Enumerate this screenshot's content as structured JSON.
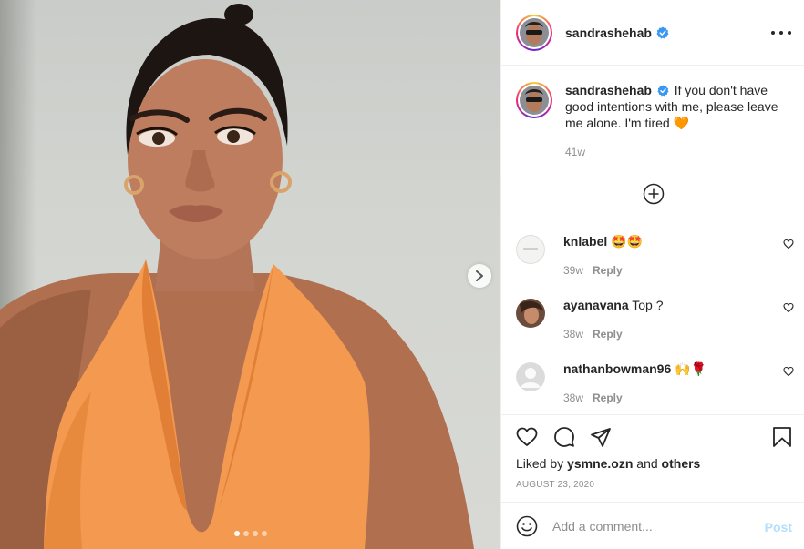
{
  "post": {
    "username": "sandrashehab",
    "verified": true,
    "caption_text": "If you don't have good intentions with me, please leave me alone. I'm tired",
    "caption_emoji": "🧡",
    "caption_time": "41w",
    "carousel": {
      "total_slides": 4,
      "active_slide": 1
    }
  },
  "comments": [
    {
      "username": "knlabel",
      "text": "🤩🤩",
      "time": "39w",
      "reply_label": "Reply"
    },
    {
      "username": "ayanavana",
      "text": "Top ?",
      "time": "38w",
      "reply_label": "Reply"
    },
    {
      "username": "nathanbowman96",
      "text": "🙌🌹",
      "time": "38w",
      "reply_label": "Reply"
    }
  ],
  "likes": {
    "prefix": "Liked by",
    "user": "ysmne.ozn",
    "conj": "and",
    "others": "others"
  },
  "date": "AUGUST 23, 2020",
  "add_comment": {
    "placeholder": "Add a comment...",
    "post_label": "Post"
  },
  "icons": {
    "more": "more-options-icon",
    "verified": "verified-badge-icon",
    "load_more": "plus-circle-icon",
    "heart": "heart-icon",
    "comment": "comment-icon",
    "share": "share-icon",
    "save": "bookmark-icon",
    "emoji": "emoji-icon",
    "next": "chevron-right-icon"
  },
  "colors": {
    "verified": "#3897f0",
    "post_disabled": "#b2dffc",
    "meta": "#8e8e8e",
    "heart_emoji": "#f56b2a"
  }
}
